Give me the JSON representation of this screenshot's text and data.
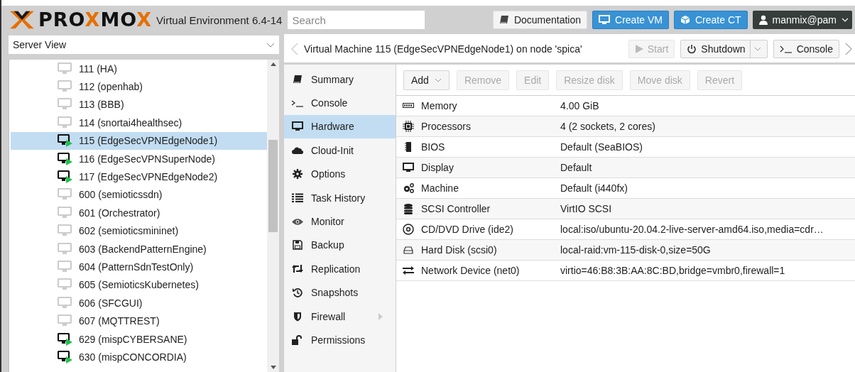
{
  "header": {
    "logo": [
      {
        "text": "PRO",
        "accent": false
      },
      {
        "text": "X",
        "accent": true
      },
      {
        "text": "MO",
        "accent": false
      },
      {
        "text": "X",
        "accent": true
      }
    ],
    "version": "Virtual Environment 6.4-14",
    "search": {
      "placeholder": "Search"
    },
    "buttons": [
      {
        "label": "Documentation",
        "kind": "docs"
      },
      {
        "label": "Create VM",
        "kind": "vm"
      },
      {
        "label": "Create CT",
        "kind": "ct"
      },
      {
        "label": "manmix@pam",
        "kind": "user"
      }
    ]
  },
  "view_selector": {
    "value": "Server View"
  },
  "tree": [
    {
      "label": "111 (HA)",
      "running": false,
      "selected": false
    },
    {
      "label": "112 (openhab)",
      "running": false,
      "selected": false
    },
    {
      "label": "113 (BBB)",
      "running": false,
      "selected": false
    },
    {
      "label": "114 (snortai4healthsec)",
      "running": false,
      "selected": false
    },
    {
      "label": "115 (EdgeSecVPNEdgeNode1)",
      "running": true,
      "selected": true
    },
    {
      "label": "116 (EdgeSecVPNSuperNode)",
      "running": true,
      "selected": false
    },
    {
      "label": "117 (EdgeSecVPNEdgeNode2)",
      "running": true,
      "selected": false
    },
    {
      "label": "600 (semioticssdn)",
      "running": false,
      "selected": false
    },
    {
      "label": "601 (Orchestrator)",
      "running": false,
      "selected": false
    },
    {
      "label": "602 (semioticsmininet)",
      "running": false,
      "selected": false
    },
    {
      "label": "603 (BackendPatternEngine)",
      "running": false,
      "selected": false
    },
    {
      "label": "604 (PatternSdnTestOnly)",
      "running": false,
      "selected": false
    },
    {
      "label": "605 (SemioticsKubernetes)",
      "running": false,
      "selected": false
    },
    {
      "label": "606 (SFCGUI)",
      "running": false,
      "selected": false
    },
    {
      "label": "607 (MQTTREST)",
      "running": false,
      "selected": false
    },
    {
      "label": "629 (mispCYBERSANE)",
      "running": true,
      "selected": false
    },
    {
      "label": "630 (mispCONCORDIA)",
      "running": true,
      "selected": false
    }
  ],
  "title_bar": {
    "title": "Virtual Machine 115 (EdgeSecVPNEdgeNode1) on node 'spica'",
    "actions": [
      {
        "label": "Start",
        "kind": "start",
        "disabled": true,
        "dropdown": false
      },
      {
        "label": "Shutdown",
        "kind": "shutdown",
        "disabled": false,
        "dropdown": true
      },
      {
        "label": "Console",
        "kind": "console",
        "disabled": false,
        "dropdown": false
      }
    ]
  },
  "nav": [
    {
      "label": "Summary",
      "kind": "summary",
      "selected": false,
      "expandable": false
    },
    {
      "label": "Console",
      "kind": "console",
      "selected": false,
      "expandable": false
    },
    {
      "label": "Hardware",
      "kind": "hardware",
      "selected": true,
      "expandable": false
    },
    {
      "label": "Cloud-Init",
      "kind": "cloud",
      "selected": false,
      "expandable": false
    },
    {
      "label": "Options",
      "kind": "options",
      "selected": false,
      "expandable": false
    },
    {
      "label": "Task History",
      "kind": "tasks",
      "selected": false,
      "expandable": false
    },
    {
      "label": "Monitor",
      "kind": "monitor",
      "selected": false,
      "expandable": false
    },
    {
      "label": "Backup",
      "kind": "backup",
      "selected": false,
      "expandable": false
    },
    {
      "label": "Replication",
      "kind": "replication",
      "selected": false,
      "expandable": false
    },
    {
      "label": "Snapshots",
      "kind": "snapshots",
      "selected": false,
      "expandable": false
    },
    {
      "label": "Firewall",
      "kind": "firewall",
      "selected": false,
      "expandable": true
    },
    {
      "label": "Permissions",
      "kind": "permissions",
      "selected": false,
      "expandable": false
    }
  ],
  "toolbar": [
    {
      "label": "Add",
      "disabled": false,
      "dropdown": true
    },
    {
      "label": "Remove",
      "disabled": true,
      "dropdown": false
    },
    {
      "label": "Edit",
      "disabled": true,
      "dropdown": false
    },
    {
      "label": "Resize disk",
      "disabled": true,
      "dropdown": false
    },
    {
      "label": "Move disk",
      "disabled": true,
      "dropdown": false
    },
    {
      "label": "Revert",
      "disabled": true,
      "dropdown": false
    }
  ],
  "hardware": [
    {
      "kind": "memory",
      "name": "Memory",
      "value": "4.00 GiB"
    },
    {
      "kind": "cpu",
      "name": "Processors",
      "value": "4 (2 sockets, 2 cores)"
    },
    {
      "kind": "bios",
      "name": "BIOS",
      "value": "Default (SeaBIOS)"
    },
    {
      "kind": "display",
      "name": "Display",
      "value": "Default"
    },
    {
      "kind": "machine",
      "name": "Machine",
      "value": "Default (i440fx)"
    },
    {
      "kind": "scsi",
      "name": "SCSI Controller",
      "value": "VirtIO SCSI"
    },
    {
      "kind": "cdrom",
      "name": "CD/DVD Drive (ide2)",
      "value": "local:iso/ubuntu-20.04.2-live-server-amd64.iso,media=cdr…"
    },
    {
      "kind": "disk",
      "name": "Hard Disk (scsi0)",
      "value": "local-raid:vm-115-disk-0,size=50G"
    },
    {
      "kind": "network",
      "name": "Network Device (net0)",
      "value": "virtio=46:B8:3B:AA:8C:BD,bridge=vmbr0,firewall=1"
    }
  ]
}
